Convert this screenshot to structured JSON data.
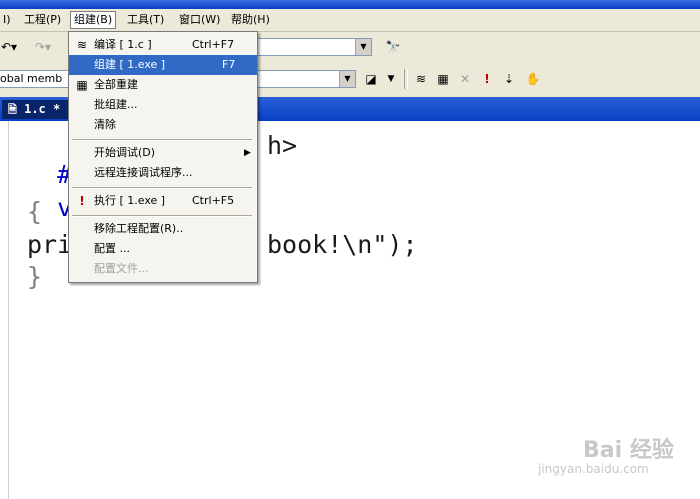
{
  "menubar": {
    "items": [
      "I)",
      "工程(P)",
      "组建(B)",
      "工具(T)",
      "窗口(W)",
      "帮助(H)"
    ]
  },
  "toolbar2": {
    "members_combo": "obal memb"
  },
  "editor": {
    "tab_label": "1.c *",
    "lines": [
      {
        "a": "#in",
        "b": "h>"
      },
      {
        "a": "voi",
        "b": ""
      },
      {
        "a": "{",
        "b": ""
      },
      {
        "a": "pri",
        "b": "book!\\n\");"
      },
      {
        "a": "}",
        "b": ""
      }
    ]
  },
  "dropdown": {
    "items": [
      {
        "label": "编译 [ 1.c ]",
        "shortcut": "Ctrl+F7",
        "icon": "compile-icon"
      },
      {
        "label": "组建 [ 1.exe ]",
        "shortcut": "F7",
        "icon": "",
        "selected": true
      },
      {
        "label": "全部重建",
        "shortcut": "",
        "icon": "rebuild-all-icon"
      },
      {
        "label": "批组建...",
        "shortcut": "",
        "icon": ""
      },
      {
        "label": "清除",
        "shortcut": "",
        "icon": ""
      },
      {
        "label": "开始调试(D)",
        "shortcut": "",
        "icon": "",
        "submenu": true
      },
      {
        "label": "远程连接调试程序...",
        "shortcut": "",
        "icon": ""
      },
      {
        "label": "执行 [ 1.exe ]",
        "shortcut": "Ctrl+F5",
        "icon": "execute-icon"
      },
      {
        "label": "移除工程配置(R)..",
        "shortcut": "",
        "icon": ""
      },
      {
        "label": "配置 ...",
        "shortcut": "",
        "icon": ""
      },
      {
        "label": "配置文件...",
        "shortcut": "",
        "icon": "",
        "disabled": true
      }
    ]
  },
  "watermark": {
    "brand": "Bai 经验",
    "url": "jingyan.baidu.com"
  },
  "colors": {
    "selection": "#316ac5",
    "tab_active": "#0a246a",
    "keyword": "#0000c8"
  }
}
